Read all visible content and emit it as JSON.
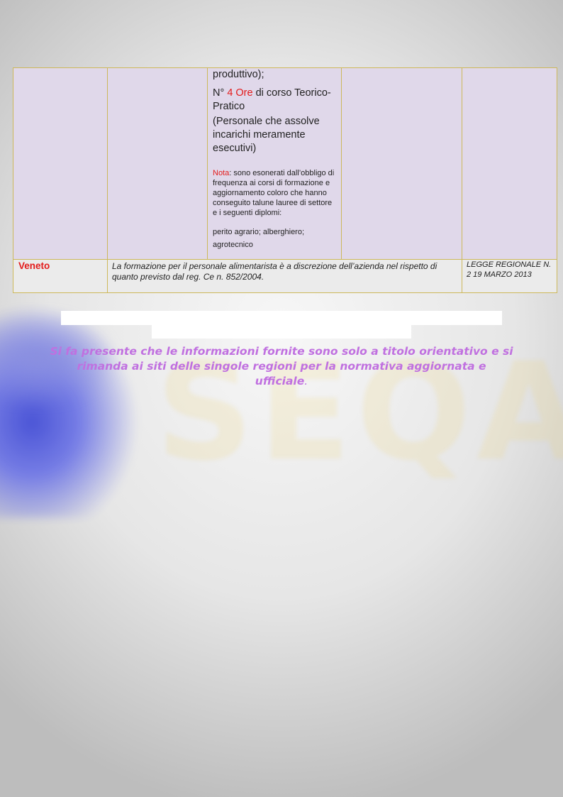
{
  "table": {
    "row1": {
      "col3": {
        "line1": "produttivo);",
        "hours_prefix": "N° ",
        "hours_value": "4 Ore",
        "hours_suffix": " di corso Teorico-Pratico",
        "staff": "(Personale che assolve incarichi meramente esecutivi)",
        "note_label": "Nota",
        "note_text": ": sono esonerati dall’obbligo di frequenza ai corsi di formazione e aggiornamento coloro che hanno conseguito talune lauree di settore e i seguenti diplomi:",
        "diplomas": "perito agrario; alberghiero; agrotecnico"
      }
    },
    "row2": {
      "region": "Veneto",
      "description": "La formazione per il personale alimentarista è a discrezione dell’azienda nel rispetto di quanto previsto dal reg. Ce n. 852/2004.",
      "law": "LEGGE REGIONALE N. 2 19 MARZO 2013"
    }
  },
  "disclaimer": {
    "text": "Si fa presente che le informazioni fornite sono solo a titolo orientativo e si rimanda ai siti delle singole regioni per la normativa aggiornata e ufficiale",
    "period": "."
  },
  "watermark": {
    "text": "SEQA"
  },
  "colors": {
    "row_purple": "#e0d8ea",
    "border_gold": "#cdb85a",
    "accent_red": "#e31b1b",
    "disclaimer_violet": "#c070e0"
  }
}
